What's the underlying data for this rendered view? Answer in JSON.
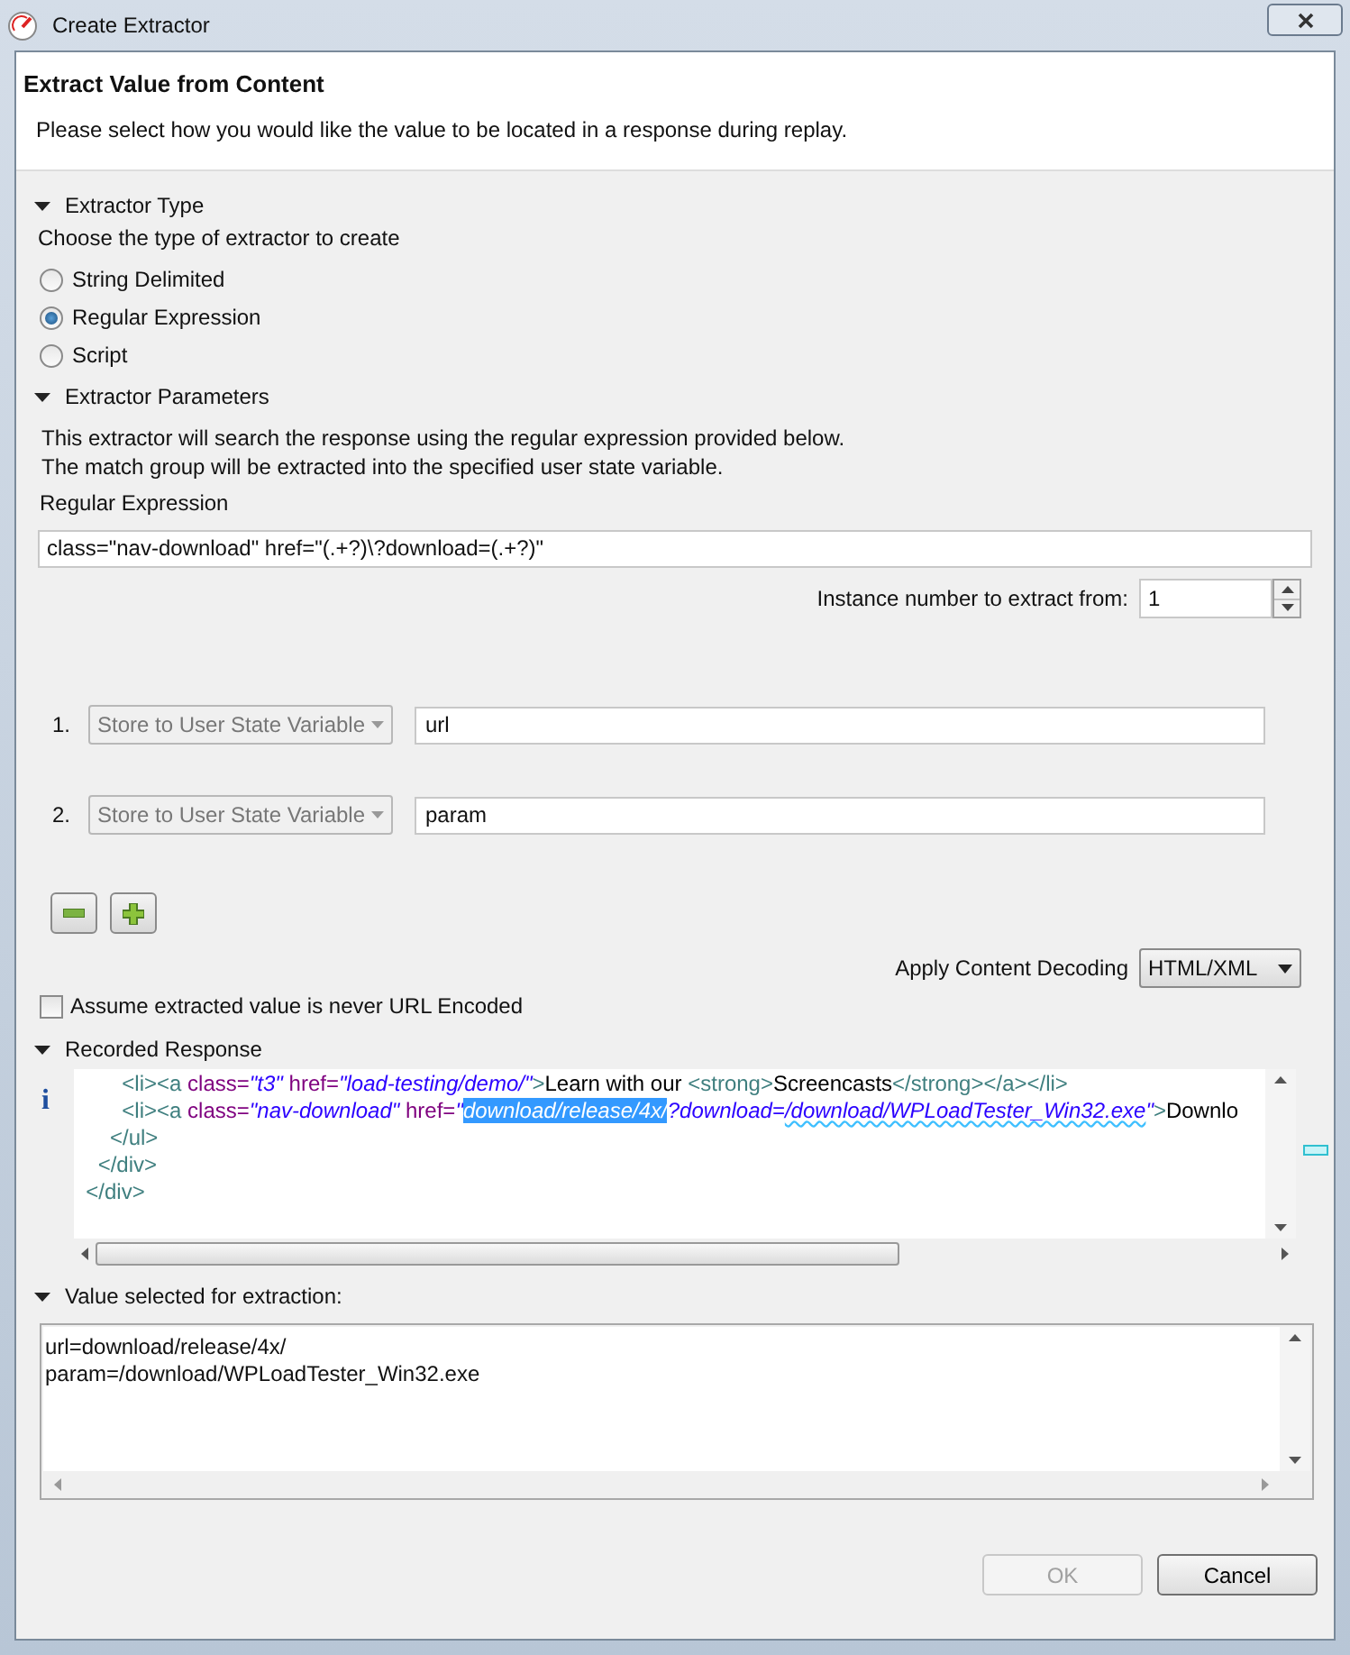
{
  "window": {
    "title": "Create Extractor"
  },
  "header": {
    "title": "Extract Value from Content",
    "description": "Please select how you would like the value to be located in a response during replay."
  },
  "extractor_type": {
    "title": "Extractor Type",
    "expanded": true,
    "description": "Choose the type of extractor to create",
    "options": [
      {
        "label": "String Delimited",
        "selected": false
      },
      {
        "label": "Regular Expression",
        "selected": true
      },
      {
        "label": "Script",
        "selected": false
      }
    ]
  },
  "extractor_parameters": {
    "title": "Extractor Parameters",
    "expanded": true,
    "description": [
      "This extractor will search the response using the regular expression provided below.",
      "The match group will be extracted into the specified user state variable."
    ],
    "regex_label": "Regular Expression",
    "regex_value": "class=\"nav-download\" href=\"(.+?)\\?download=(.+?)\"",
    "instance_label": "Instance number to extract from:",
    "instance_value": "1",
    "groups": [
      {
        "number": "1.",
        "action": "Store to User State Variable",
        "variable": "url"
      },
      {
        "number": "2.",
        "action": "Store to User State Variable",
        "variable": "param"
      }
    ],
    "decoding_label": "Apply Content Decoding",
    "decoding_value": "HTML/XML",
    "never_url_encoded": {
      "label": "Assume extracted value is never URL Encoded",
      "checked": false
    }
  },
  "recorded_response": {
    "title": "Recorded Response",
    "expanded": true,
    "info_icon": "i",
    "lines": [
      {
        "segments": [
          {
            "kind": "tag",
            "text": "        <li><a "
          },
          {
            "kind": "attr",
            "text": "class="
          },
          {
            "kind": "string",
            "text": "\"t3\""
          },
          {
            "kind": "attr",
            "text": " href="
          },
          {
            "kind": "string",
            "text": "\"load-testing/demo/\""
          },
          {
            "kind": "tag",
            "text": ">"
          },
          {
            "kind": "text",
            "text": "Learn with our "
          },
          {
            "kind": "tag",
            "text": "<strong>"
          },
          {
            "kind": "text",
            "text": "Screencasts"
          },
          {
            "kind": "tag",
            "text": "</strong></a></li>"
          }
        ]
      },
      {
        "segments": [
          {
            "kind": "tag",
            "text": "        <li><a "
          },
          {
            "kind": "attr",
            "text": "class="
          },
          {
            "kind": "string",
            "text": "\"nav-download\""
          },
          {
            "kind": "attr",
            "text": " href="
          },
          {
            "kind": "string",
            "text": "\""
          },
          {
            "kind": "selected",
            "text": "download/release/4x/"
          },
          {
            "kind": "string",
            "text": "?download="
          },
          {
            "kind": "flagged",
            "text": "/download/WPLoadTester_Win32.exe"
          },
          {
            "kind": "string",
            "text": "\""
          },
          {
            "kind": "tag",
            "text": ">"
          },
          {
            "kind": "text",
            "text": "Downlo"
          }
        ]
      },
      {
        "segments": [
          {
            "kind": "tag",
            "text": "      </ul>"
          }
        ]
      },
      {
        "segments": [
          {
            "kind": "tag",
            "text": "    </div>"
          }
        ]
      },
      {
        "segments": [
          {
            "kind": "tag",
            "text": "  </div>"
          }
        ]
      }
    ]
  },
  "value_selected": {
    "title": "Value selected for extraction:",
    "expanded": true,
    "lines": [
      "url=download/release/4x/",
      "param=/download/WPLoadTester_Win32.exe"
    ]
  },
  "buttons": [
    {
      "label": "OK",
      "disabled": true
    },
    {
      "label": "Cancel",
      "disabled": false
    }
  ]
}
